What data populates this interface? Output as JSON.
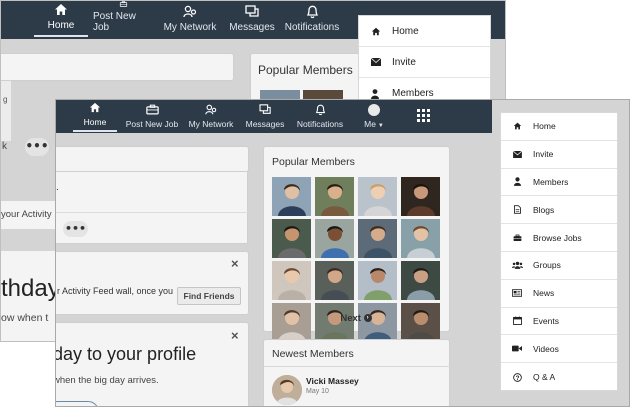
{
  "back_window": {
    "nav": [
      {
        "label": "Home",
        "icon": "home-icon"
      },
      {
        "label": "Post New Job",
        "icon": "briefcase-icon"
      },
      {
        "label": "My Network",
        "icon": "network-icon"
      },
      {
        "label": "Messages",
        "icon": "messages-icon"
      },
      {
        "label": "Notifications",
        "icon": "bell-icon"
      }
    ],
    "popular_members_title": "Popular Members",
    "activity_fragment": "your Activity Fe",
    "birthday_fragment": "thday",
    "when_fragment": "ow when t",
    "tick_fragment": "g",
    "letter_fragment": "k",
    "menu": [
      {
        "label": "Home",
        "icon": "home-icon"
      },
      {
        "label": "Invite",
        "icon": "envelope-icon"
      },
      {
        "label": "Members",
        "icon": "user-icon"
      }
    ]
  },
  "front_window": {
    "nav": [
      {
        "label": "Home",
        "icon": "home-icon"
      },
      {
        "label": "Post New Job",
        "icon": "briefcase-icon"
      },
      {
        "label": "My Network",
        "icon": "network-icon"
      },
      {
        "label": "Messages",
        "icon": "messages-icon"
      },
      {
        "label": "Notifications",
        "icon": "bell-icon"
      },
      {
        "label": "Me",
        "icon": "avatar-icon"
      }
    ],
    "apps_icon": "grid-icon",
    "left_column": {
      "period_fragment": ".",
      "activity_text": "r Activity Feed wall, once you",
      "find_friends_label": "Find Friends",
      "birthday_heading": "day to your profile",
      "birthday_sub": "when the big day arrives.",
      "close_symbol": "×"
    },
    "popular_members": {
      "title": "Popular Members",
      "next_label": "Next",
      "count": 16
    },
    "newest_members": {
      "title": "Newest Members",
      "member_name": "Vicki Massey",
      "member_date": "May 10"
    },
    "menu": [
      {
        "label": "Home",
        "icon": "home-icon"
      },
      {
        "label": "Invite",
        "icon": "envelope-icon"
      },
      {
        "label": "Members",
        "icon": "user-icon"
      },
      {
        "label": "Blogs",
        "icon": "document-icon"
      },
      {
        "label": "Browse Jobs",
        "icon": "briefcase-icon"
      },
      {
        "label": "Groups",
        "icon": "users-icon"
      },
      {
        "label": "News",
        "icon": "newspaper-icon"
      },
      {
        "label": "Events",
        "icon": "calendar-icon"
      },
      {
        "label": "Videos",
        "icon": "video-icon"
      },
      {
        "label": "Q & A",
        "icon": "question-icon"
      }
    ]
  },
  "colors": {
    "nav_bg": "#2d3a48",
    "page_bg": "#d4d4d4",
    "card_bg": "#f4f4f4"
  }
}
